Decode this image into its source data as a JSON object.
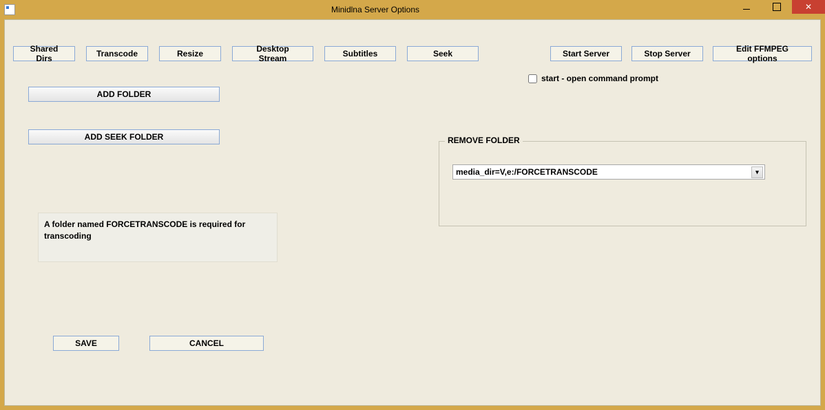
{
  "window": {
    "title": "Minidlna Server Options"
  },
  "toolbar": {
    "shared_dirs": "Shared Dirs",
    "transcode": "Transcode",
    "resize": "Resize",
    "desktop_stream": "Desktop Stream",
    "subtitles": "Subtitles",
    "seek": "Seek",
    "start_server": "Start Server",
    "stop_server": "Stop Server",
    "edit_ffmpeg": "Edit FFMPEG options"
  },
  "checkbox": {
    "start_open_cmd": "start - open command prompt",
    "checked": false
  },
  "buttons": {
    "add_folder": "ADD FOLDER",
    "add_seek_folder": "ADD SEEK FOLDER",
    "save": "SAVE",
    "cancel": "CANCEL"
  },
  "info": {
    "text": "A folder named FORCETRANSCODE is required for transcoding"
  },
  "remove_folder": {
    "label": "REMOVE FOLDER",
    "selected": "media_dir=V,e:/FORCETRANSCODE"
  }
}
